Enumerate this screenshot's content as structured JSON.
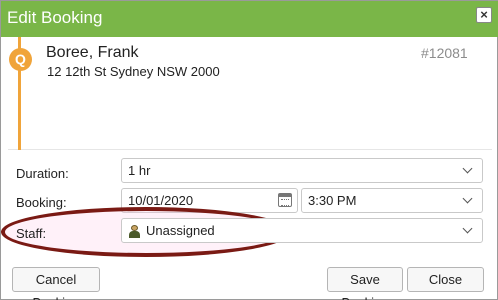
{
  "dialog": {
    "title": "Edit Booking",
    "close_glyph": "×",
    "accent_color": "#7ab648"
  },
  "card": {
    "status_letter": "Q",
    "status_color": "#f0a43a",
    "customer_name": "Boree, Frank",
    "address": "12 12th St Sydney NSW 2000",
    "booking_id": "#12081"
  },
  "form": {
    "duration": {
      "label": "Duration:",
      "value": "1 hr"
    },
    "booking": {
      "label": "Booking:",
      "date": "10/01/2020",
      "time": "3:30 PM"
    },
    "staff": {
      "label": "Staff:",
      "value": "Unassigned",
      "icon": "person-icon"
    }
  },
  "footer": {
    "cancel_booking": "Cancel Booking",
    "save_booking": "Save Booking",
    "close": "Close"
  }
}
